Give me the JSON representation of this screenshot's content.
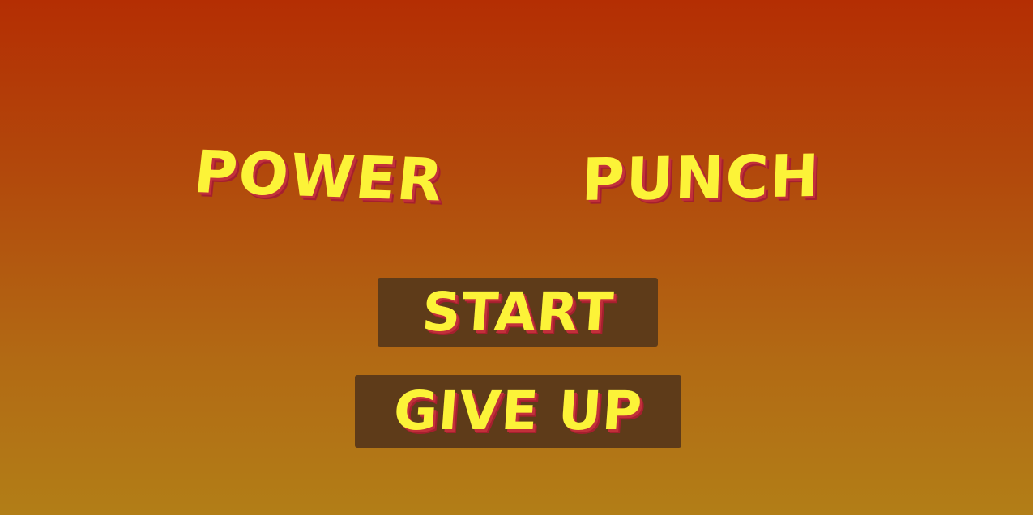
{
  "title": {
    "word1": "POWER",
    "word2": "PUNCH"
  },
  "menu": {
    "start_label": "START",
    "give_up_label": "GIVE UP"
  },
  "colors": {
    "text": "#fcf338",
    "text_shadow": "#c2303a",
    "button_bg": "#5e3b19",
    "bg_top": "#b42e03",
    "bg_bottom": "#b27e17"
  }
}
